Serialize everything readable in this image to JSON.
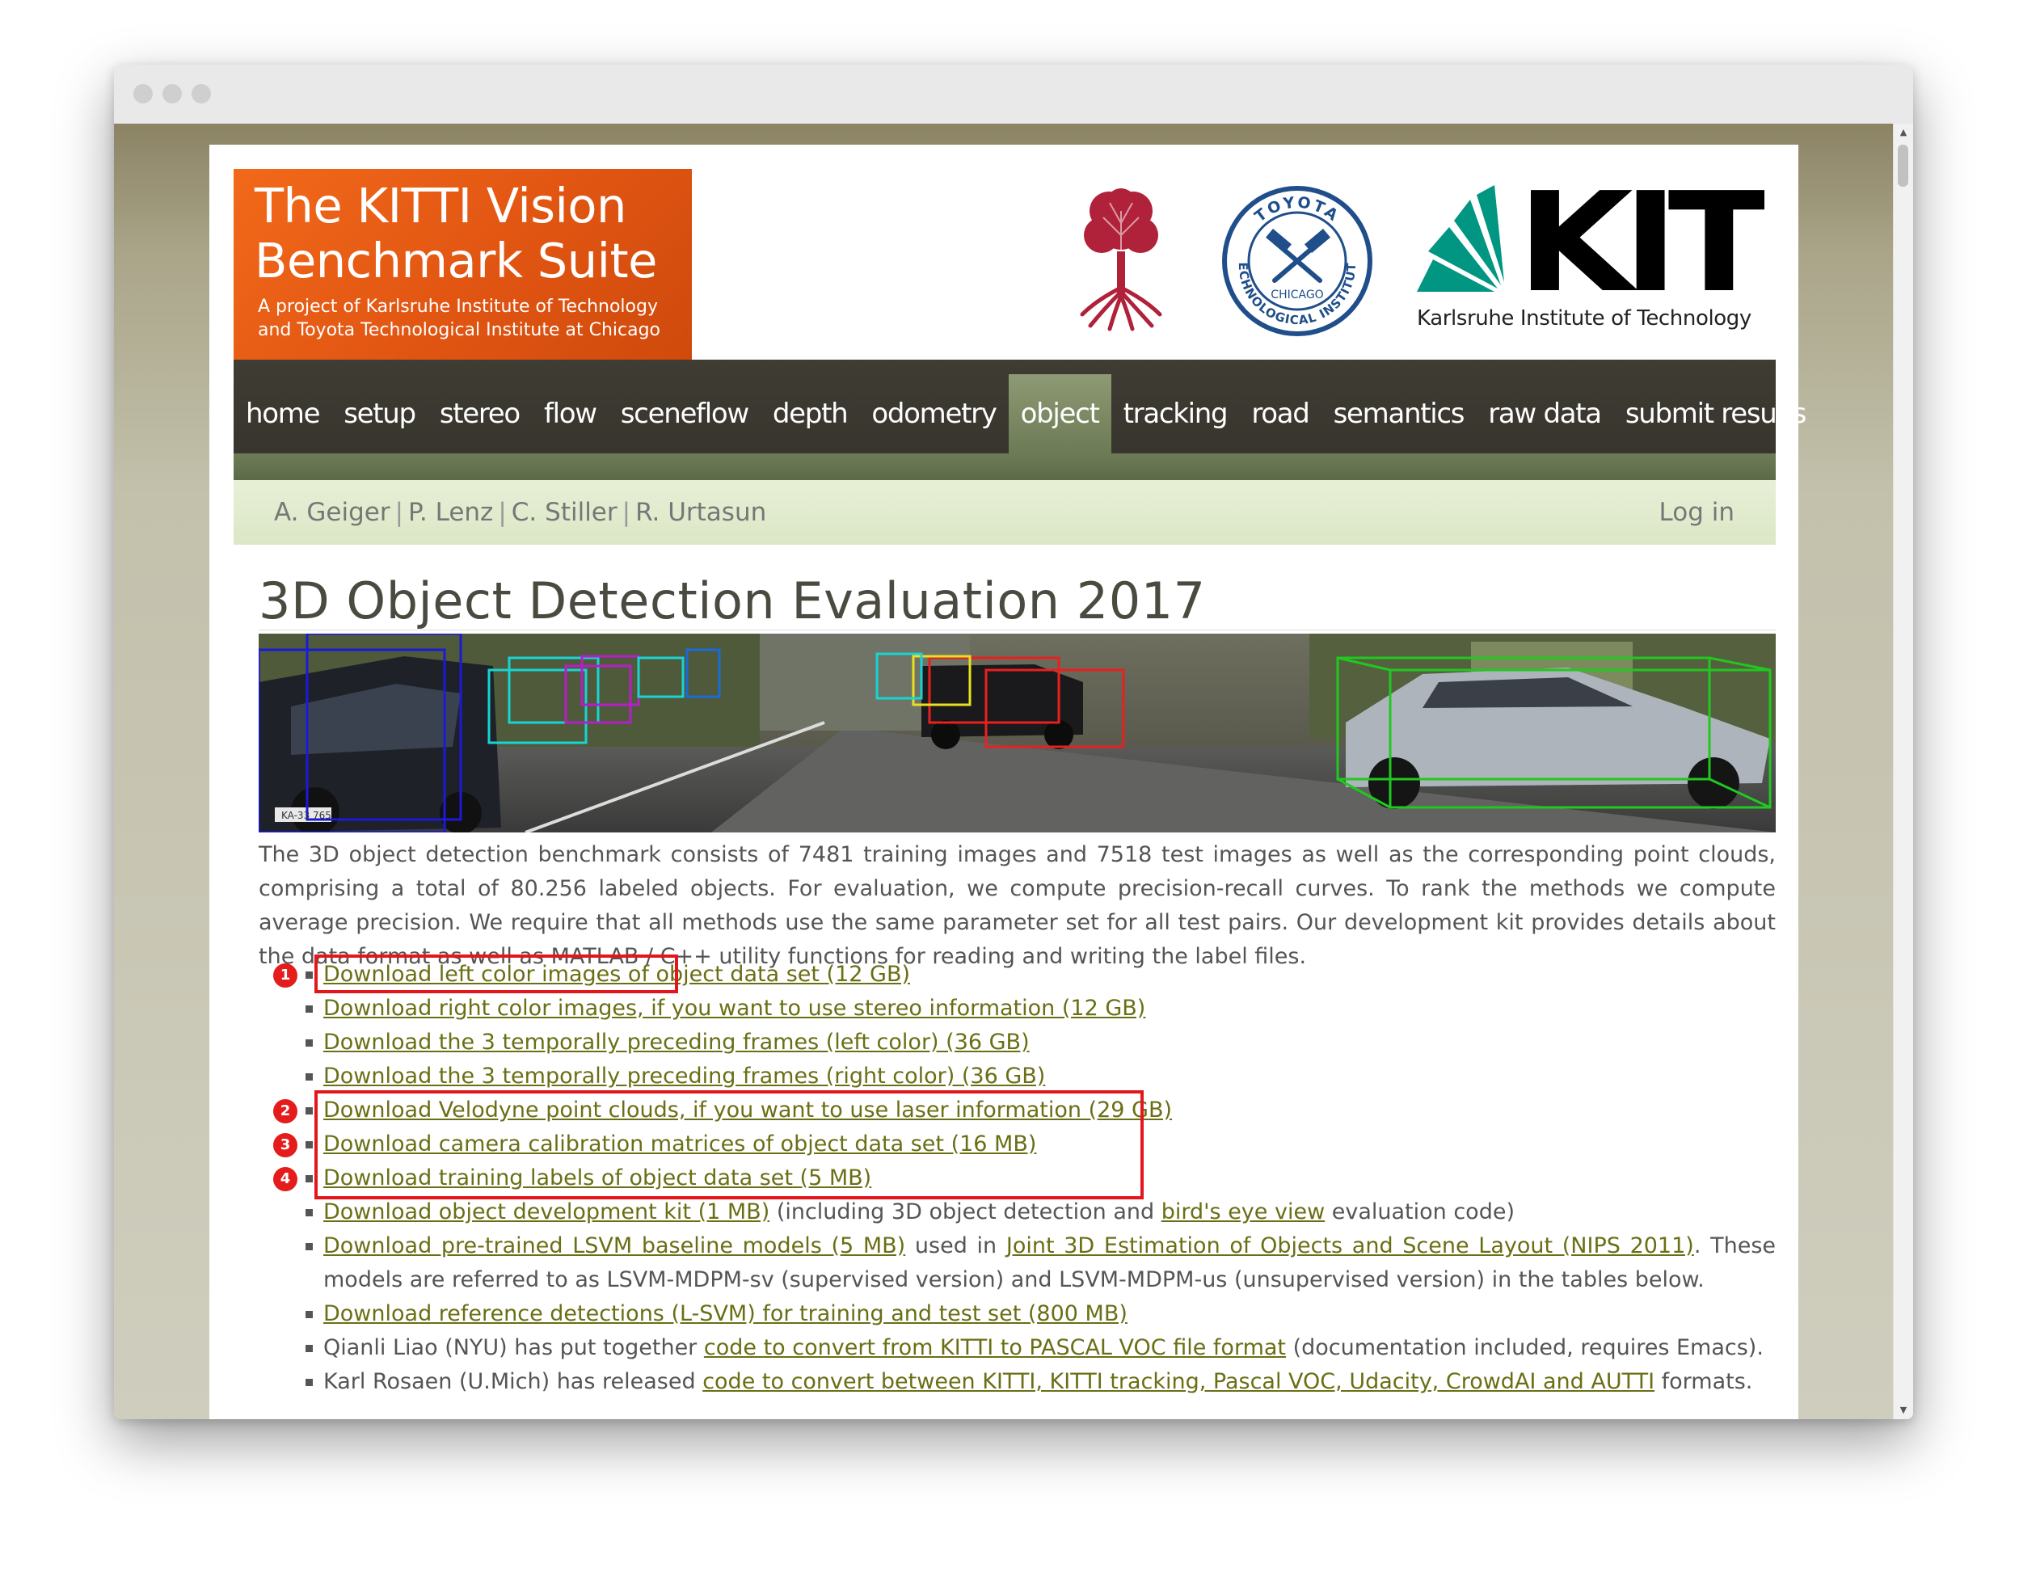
{
  "page": {
    "banner": {
      "title": "The KITTI Vision Benchmark Suite",
      "subtitle": "A project of Karlsruhe Institute of Technology and Toyota Technological Institute at Chicago"
    },
    "logos": {
      "tti": {
        "top_text": "TOYOTA",
        "middle_text": "TECHNOLOGICAL INSTITUTE",
        "city": "CHICAGO"
      },
      "kit": {
        "wordmark": "KIT",
        "caption": "Karlsruhe Institute of Technology"
      }
    },
    "nav": [
      {
        "label": "home",
        "active": false
      },
      {
        "label": "setup",
        "active": false
      },
      {
        "label": "stereo",
        "active": false
      },
      {
        "label": "flow",
        "active": false
      },
      {
        "label": "sceneflow",
        "active": false
      },
      {
        "label": "depth",
        "active": false
      },
      {
        "label": "odometry",
        "active": false
      },
      {
        "label": "object",
        "active": true
      },
      {
        "label": "tracking",
        "active": false
      },
      {
        "label": "road",
        "active": false
      },
      {
        "label": "semantics",
        "active": false
      },
      {
        "label": "raw data",
        "active": false
      },
      {
        "label": "submit results",
        "active": false
      }
    ],
    "authors": [
      "A. Geiger",
      "P. Lenz",
      "C. Stiller",
      "R. Urtasun"
    ],
    "author_separator": "|",
    "login_label": "Log in",
    "title": "3D Object Detection Evaluation 2017",
    "hero_plate": "KA-33 765",
    "intro": "The 3D object detection benchmark consists of 7481 training images and 7518 test images as well as the corresponding point clouds, comprising a total of 80.256 labeled objects. For evaluation, we compute precision-recall curves. To rank the methods we compute average precision. We require that all methods use the same parameter set for all test pairs. Our development kit provides details about the data format as well as MATLAB / C++ utility functions for reading and writing the label files.",
    "downloads": [
      {
        "marker": "1",
        "parts": [
          {
            "link": "Download left color images of object data set (12 GB)"
          }
        ]
      },
      {
        "marker": "",
        "parts": [
          {
            "link": "Download right color images, if you want to use stereo information (12 GB)"
          }
        ]
      },
      {
        "marker": "",
        "parts": [
          {
            "link": "Download the 3 temporally preceding frames (left color) (36 GB)"
          }
        ]
      },
      {
        "marker": "",
        "parts": [
          {
            "link": "Download the 3 temporally preceding frames (right color) (36 GB)"
          }
        ]
      },
      {
        "marker": "2",
        "parts": [
          {
            "link": "Download Velodyne point clouds, if you want to use laser information (29 GB)"
          }
        ]
      },
      {
        "marker": "3",
        "parts": [
          {
            "link": "Download camera calibration matrices of object data set (16 MB)"
          }
        ]
      },
      {
        "marker": "4",
        "parts": [
          {
            "link": "Download training labels of object data set (5 MB)"
          }
        ]
      },
      {
        "marker": "",
        "parts": [
          {
            "link": "Download object development kit (1 MB)"
          },
          {
            "text": " (including 3D object detection and "
          },
          {
            "link": "bird's eye view"
          },
          {
            "text": " evaluation code)"
          }
        ]
      },
      {
        "marker": "",
        "parts": [
          {
            "link": "Download pre-trained LSVM baseline models (5 MB)"
          },
          {
            "text": " used in "
          },
          {
            "link": "Joint 3D Estimation of Objects and Scene Layout (NIPS 2011)"
          },
          {
            "text": ". These models are referred to as LSVM-MDPM-sv (supervised version) and LSVM-MDPM-us (unsupervised version) in the tables below."
          }
        ]
      },
      {
        "marker": "",
        "parts": [
          {
            "link": "Download reference detections (L-SVM) for training and test set (800 MB)"
          }
        ]
      },
      {
        "marker": "",
        "parts": [
          {
            "text": "Qianli Liao (NYU) has put together "
          },
          {
            "link": "code to convert from KITTI to PASCAL VOC file format"
          },
          {
            "text": " (documentation included, requires Emacs)."
          }
        ]
      },
      {
        "marker": "",
        "parts": [
          {
            "text": "Karl Rosaen (U.Mich) has released "
          },
          {
            "link": "code to convert between KITTI, KITTI tracking, Pascal VOC, Udacity, CrowdAI and AUTTI"
          },
          {
            "text": " formats."
          }
        ]
      }
    ],
    "colors": {
      "banner_orange": "#e15512",
      "nav_dark": "#3a382f",
      "nav_active": "#7a8761",
      "link_olive": "#6a6f15",
      "highlight_red": "#e3171b"
    }
  }
}
